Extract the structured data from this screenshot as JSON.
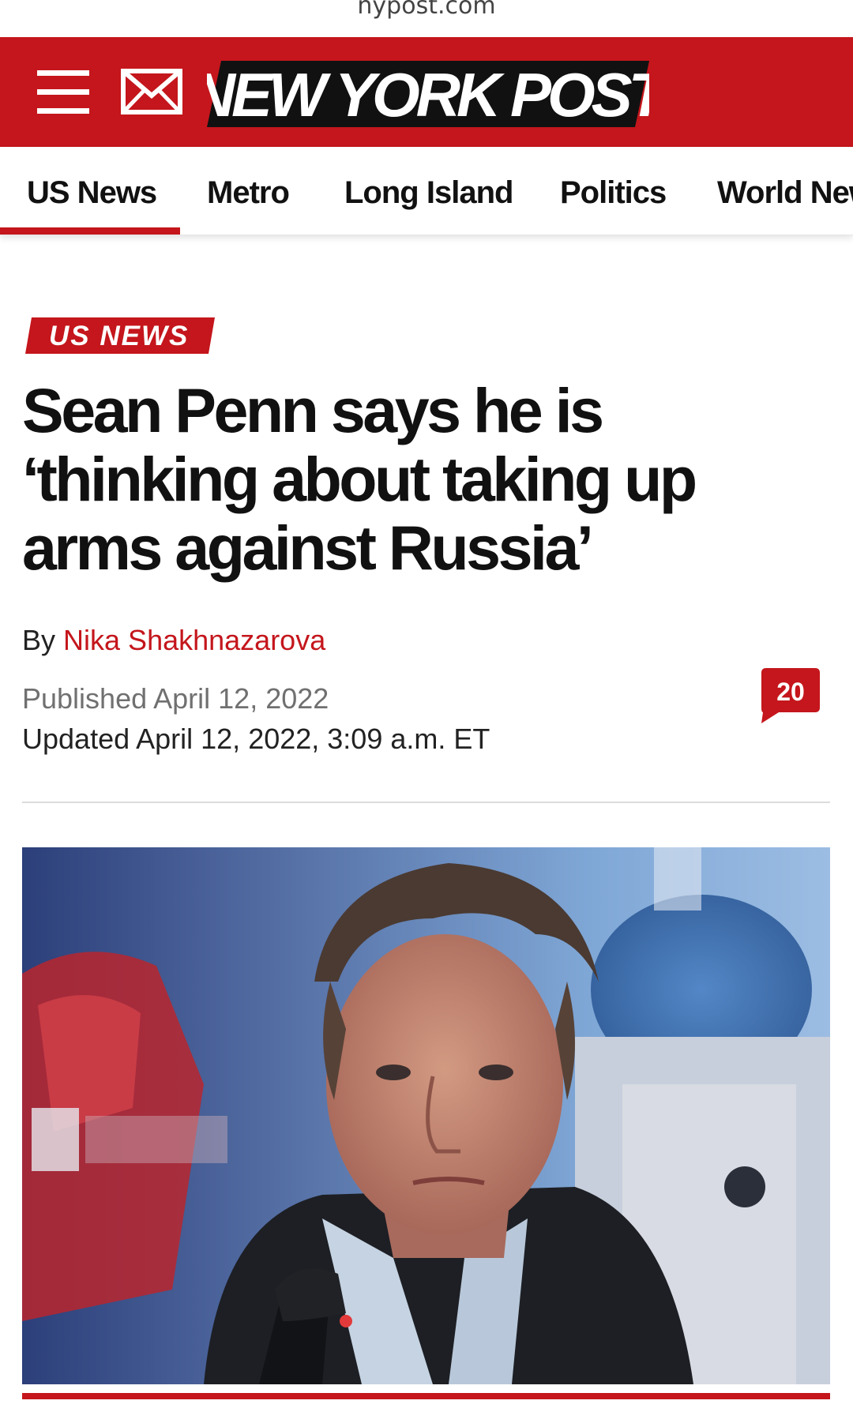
{
  "browser": {
    "url": "nypost.com"
  },
  "header": {
    "logo_text": "NEW YORK POST",
    "brand_color": "#c4161c",
    "icons": [
      "menu-icon",
      "mail-icon"
    ]
  },
  "nav": {
    "items": [
      {
        "label": "US News",
        "active": true
      },
      {
        "label": "Metro",
        "active": false
      },
      {
        "label": "Long Island",
        "active": false
      },
      {
        "label": "Politics",
        "active": false
      },
      {
        "label": "World New",
        "active": false
      }
    ]
  },
  "article": {
    "kicker": "US NEWS",
    "headline": "Sean Penn says he is ‘thinking about taking up arms against Russia’",
    "byline_prefix": "By",
    "author": "Nika Shakhnazarova",
    "published": "Published April 12, 2022",
    "updated": "Updated April 12, 2022, 3:09 a.m. ET",
    "comment_count": "20"
  }
}
